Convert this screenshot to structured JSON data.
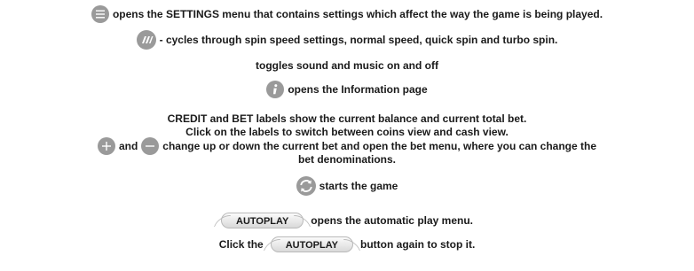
{
  "lines": {
    "settings": "opens the SETTINGS menu that contains settings which affect the way the game is being played.",
    "spin_speed": "- cycles through spin speed settings, normal speed, quick spin and turbo spin.",
    "sound": "toggles sound and music on and off",
    "info": "opens the Information page",
    "credit_bet_1": "CREDIT and BET labels show the current balance and current total bet.",
    "credit_bet_2": "Click on the labels to switch between coins view and cash view.",
    "bet_and": "and",
    "bet_change_1": "change up or down the current bet and open the bet menu, where you can change the",
    "bet_change_2": "bet denominations.",
    "spin": "starts the game",
    "autoplay_opens": "opens the automatic play menu.",
    "autoplay_click_pre": "Click the",
    "autoplay_click_post": "button again to stop it."
  },
  "buttons": {
    "autoplay_label": "AUTOPLAY"
  },
  "icons": {
    "settings": "menu-icon",
    "spin_speed": "turbo-spin-icon",
    "info": "info-icon",
    "plus": "plus-icon",
    "minus": "minus-icon",
    "spin": "spin-icon"
  },
  "colors": {
    "icon_gray": "#9a9a9a",
    "text": "#1a1a1a"
  }
}
